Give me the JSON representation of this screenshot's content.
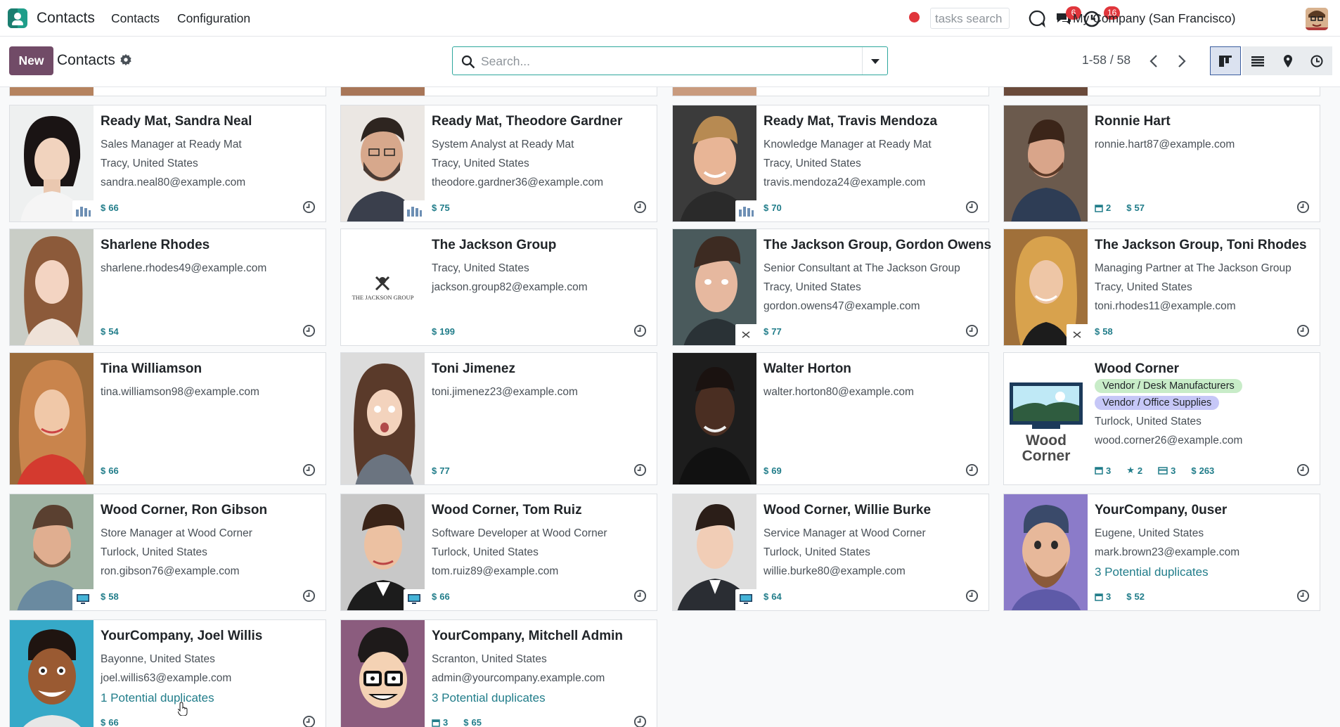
{
  "navbar": {
    "app_name": "Contacts",
    "menu": [
      "Contacts",
      "Configuration"
    ],
    "tasks_search_placeholder": "tasks search",
    "messages_badge": "6",
    "activities_badge": "16",
    "company": "My Company (San Francisco)"
  },
  "control": {
    "new_label": "New",
    "title": "Contacts",
    "search_placeholder": "Search...",
    "pager": "1-58 / 58"
  },
  "colors": {
    "accent": "#714b67",
    "link": "#217d8a",
    "tag_green": "#c8ecc8",
    "tag_purple": "#c6c7f7",
    "badge": "#e0353b"
  },
  "cards": [
    {
      "name": "Ready Mat, Sandra Neal",
      "lines": [
        "Sales Manager at Ready Mat",
        "Tracy, United States",
        "sandra.neal80@example.com"
      ],
      "stats": [
        {
          "icon": "money-icon",
          "value": "66"
        }
      ]
    },
    {
      "name": "Ready Mat, Theodore Gardner",
      "lines": [
        "System Analyst at Ready Mat",
        "Tracy, United States",
        "theodore.gardner36@example.com"
      ],
      "stats": [
        {
          "icon": "money-icon",
          "value": "75"
        }
      ]
    },
    {
      "name": "Ready Mat, Travis Mendoza",
      "lines": [
        "Knowledge Manager at Ready Mat",
        "Tracy, United States",
        "travis.mendoza24@example.com"
      ],
      "stats": [
        {
          "icon": "money-icon",
          "value": "70"
        }
      ]
    },
    {
      "name": "Ronnie Hart",
      "lines": [
        "ronnie.hart87@example.com"
      ],
      "stats": [
        {
          "icon": "calendar-icon",
          "value": "2"
        },
        {
          "icon": "money-icon",
          "value": "57"
        }
      ]
    },
    {
      "name": "Sharlene Rhodes",
      "lines": [
        "sharlene.rhodes49@example.com"
      ],
      "stats": [
        {
          "icon": "money-icon",
          "value": "54"
        }
      ]
    },
    {
      "name": "The Jackson Group",
      "lines": [
        "Tracy, United States",
        "jackson.group82@example.com"
      ],
      "logo_text": "THE JACKSON GROUP",
      "stats": [
        {
          "icon": "money-icon",
          "value": "199"
        }
      ]
    },
    {
      "name": "The Jackson Group, Gordon Owens",
      "lines": [
        "Senior Consultant at The Jackson Group",
        "Tracy, United States",
        "gordon.owens47@example.com"
      ],
      "stats": [
        {
          "icon": "money-icon",
          "value": "77"
        }
      ]
    },
    {
      "name": "The Jackson Group, Toni Rhodes",
      "lines": [
        "Managing Partner at The Jackson Group",
        "Tracy, United States",
        "toni.rhodes11@example.com"
      ],
      "stats": [
        {
          "icon": "money-icon",
          "value": "58"
        }
      ]
    },
    {
      "name": "Tina Williamson",
      "lines": [
        "tina.williamson98@example.com"
      ],
      "stats": [
        {
          "icon": "money-icon",
          "value": "66"
        }
      ]
    },
    {
      "name": "Toni Jimenez",
      "lines": [
        "toni.jimenez23@example.com"
      ],
      "stats": [
        {
          "icon": "money-icon",
          "value": "77"
        }
      ]
    },
    {
      "name": "Walter Horton",
      "lines": [
        "walter.horton80@example.com"
      ],
      "stats": [
        {
          "icon": "money-icon",
          "value": "69"
        }
      ]
    },
    {
      "name": "Wood Corner",
      "tags": [
        "Vendor / Desk Manufacturers",
        "Vendor / Office Supplies"
      ],
      "lines": [
        "Turlock, United States",
        "wood.corner26@example.com"
      ],
      "logo_text": [
        "Wood",
        "Corner"
      ],
      "stats": [
        {
          "icon": "calendar-icon",
          "value": "3"
        },
        {
          "icon": "star-icon",
          "value": "2"
        },
        {
          "icon": "card-icon",
          "value": "3"
        },
        {
          "icon": "money-icon",
          "value": "263"
        }
      ]
    },
    {
      "name": "Wood Corner, Ron Gibson",
      "lines": [
        "Store Manager at Wood Corner",
        "Turlock, United States",
        "ron.gibson76@example.com"
      ],
      "stats": [
        {
          "icon": "money-icon",
          "value": "58"
        }
      ]
    },
    {
      "name": "Wood Corner, Tom Ruiz",
      "lines": [
        "Software Developer at Wood Corner",
        "Turlock, United States",
        "tom.ruiz89@example.com"
      ],
      "stats": [
        {
          "icon": "money-icon",
          "value": "66"
        }
      ]
    },
    {
      "name": "Wood Corner, Willie Burke",
      "lines": [
        "Service Manager at Wood Corner",
        "Turlock, United States",
        "willie.burke80@example.com"
      ],
      "stats": [
        {
          "icon": "money-icon",
          "value": "64"
        }
      ]
    },
    {
      "name": "YourCompany, 0user",
      "lines": [
        "Eugene, United States",
        "mark.brown23@example.com"
      ],
      "duplicates": "3 Potential duplicates",
      "stats": [
        {
          "icon": "calendar-icon",
          "value": "3"
        },
        {
          "icon": "money-icon",
          "value": "52"
        }
      ]
    },
    {
      "name": "YourCompany, Joel Willis",
      "lines": [
        "Bayonne, United States",
        "joel.willis63@example.com"
      ],
      "duplicates": "1 Potential duplicates",
      "stats": [
        {
          "icon": "money-icon",
          "value": "66"
        }
      ]
    },
    {
      "name": "YourCompany, Mitchell Admin",
      "lines": [
        "Scranton, United States",
        "admin@yourcompany.example.com"
      ],
      "duplicates": "3 Potential duplicates",
      "stats": [
        {
          "icon": "calendar-icon",
          "value": "3"
        },
        {
          "icon": "money-icon",
          "value": "65"
        }
      ]
    }
  ]
}
